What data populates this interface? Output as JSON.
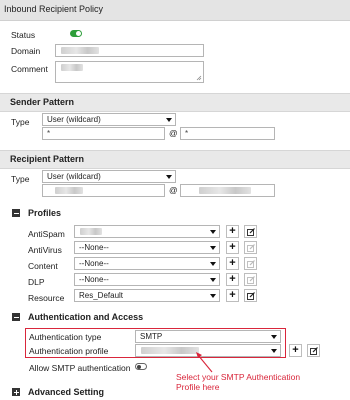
{
  "window": {
    "title": "Inbound Recipient Policy"
  },
  "general": {
    "status_label": "Status",
    "status_on": true,
    "domain_label": "Domain",
    "comment_label": "Comment"
  },
  "sender": {
    "heading": "Sender Pattern",
    "type_label": "Type",
    "type_value": "User (wildcard)",
    "user_value": "*",
    "at_sign": "@",
    "domain_value": "*"
  },
  "recipient": {
    "heading": "Recipient Pattern",
    "type_label": "Type",
    "type_value": "User (wildcard)",
    "at_sign": "@"
  },
  "profiles": {
    "heading": "Profiles",
    "rows": [
      {
        "label": "AntiSpam",
        "value": ""
      },
      {
        "label": "AntiVirus",
        "value": "--None--"
      },
      {
        "label": "Content",
        "value": "--None--"
      },
      {
        "label": "DLP",
        "value": "--None--"
      },
      {
        "label": "Resource",
        "value": "Res_Default"
      }
    ]
  },
  "auth": {
    "heading": "Authentication and Access",
    "type_label": "Authentication type",
    "type_value": "SMTP",
    "profile_label": "Authentication profile",
    "allow_smtp_label": "Allow SMTP authentication",
    "allow_smtp_on": false,
    "annotation": [
      "Select your SMTP Authentication",
      "Profile here"
    ]
  },
  "advanced": {
    "heading": "Advanced Setting"
  },
  "colors": {
    "highlight": "#d9263b",
    "toggle_on": "#2e9e3a"
  }
}
